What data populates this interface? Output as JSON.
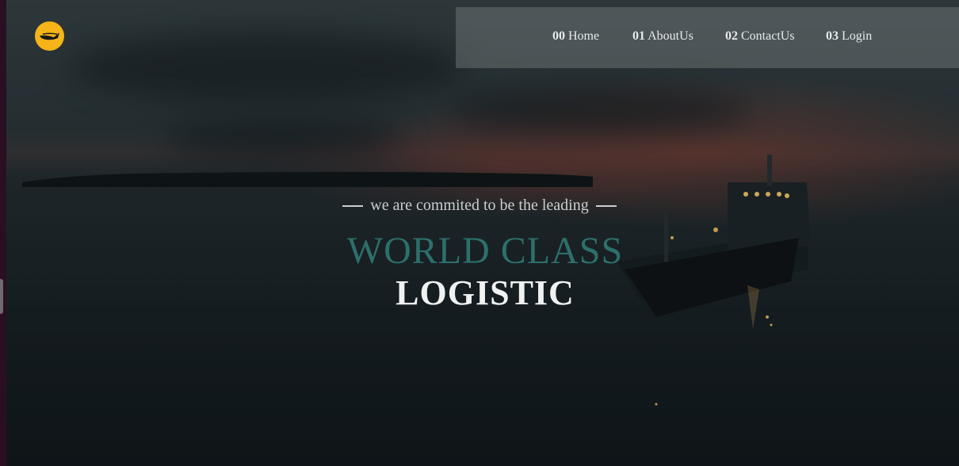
{
  "nav": {
    "items": [
      {
        "num": "00",
        "label": "Home"
      },
      {
        "num": "01",
        "label": "AboutUs"
      },
      {
        "num": "02",
        "label": "ContactUs"
      },
      {
        "num": "03",
        "label": "Login"
      }
    ]
  },
  "hero": {
    "tagline": "we are commited to be the leading",
    "title_line1": "WORLD CLASS",
    "title_line2": "LOGISTIC"
  },
  "colors": {
    "logo": "#f5b418",
    "title_accent": "#2d6f6b"
  },
  "icons": {
    "logo": "crane-logo-icon"
  }
}
